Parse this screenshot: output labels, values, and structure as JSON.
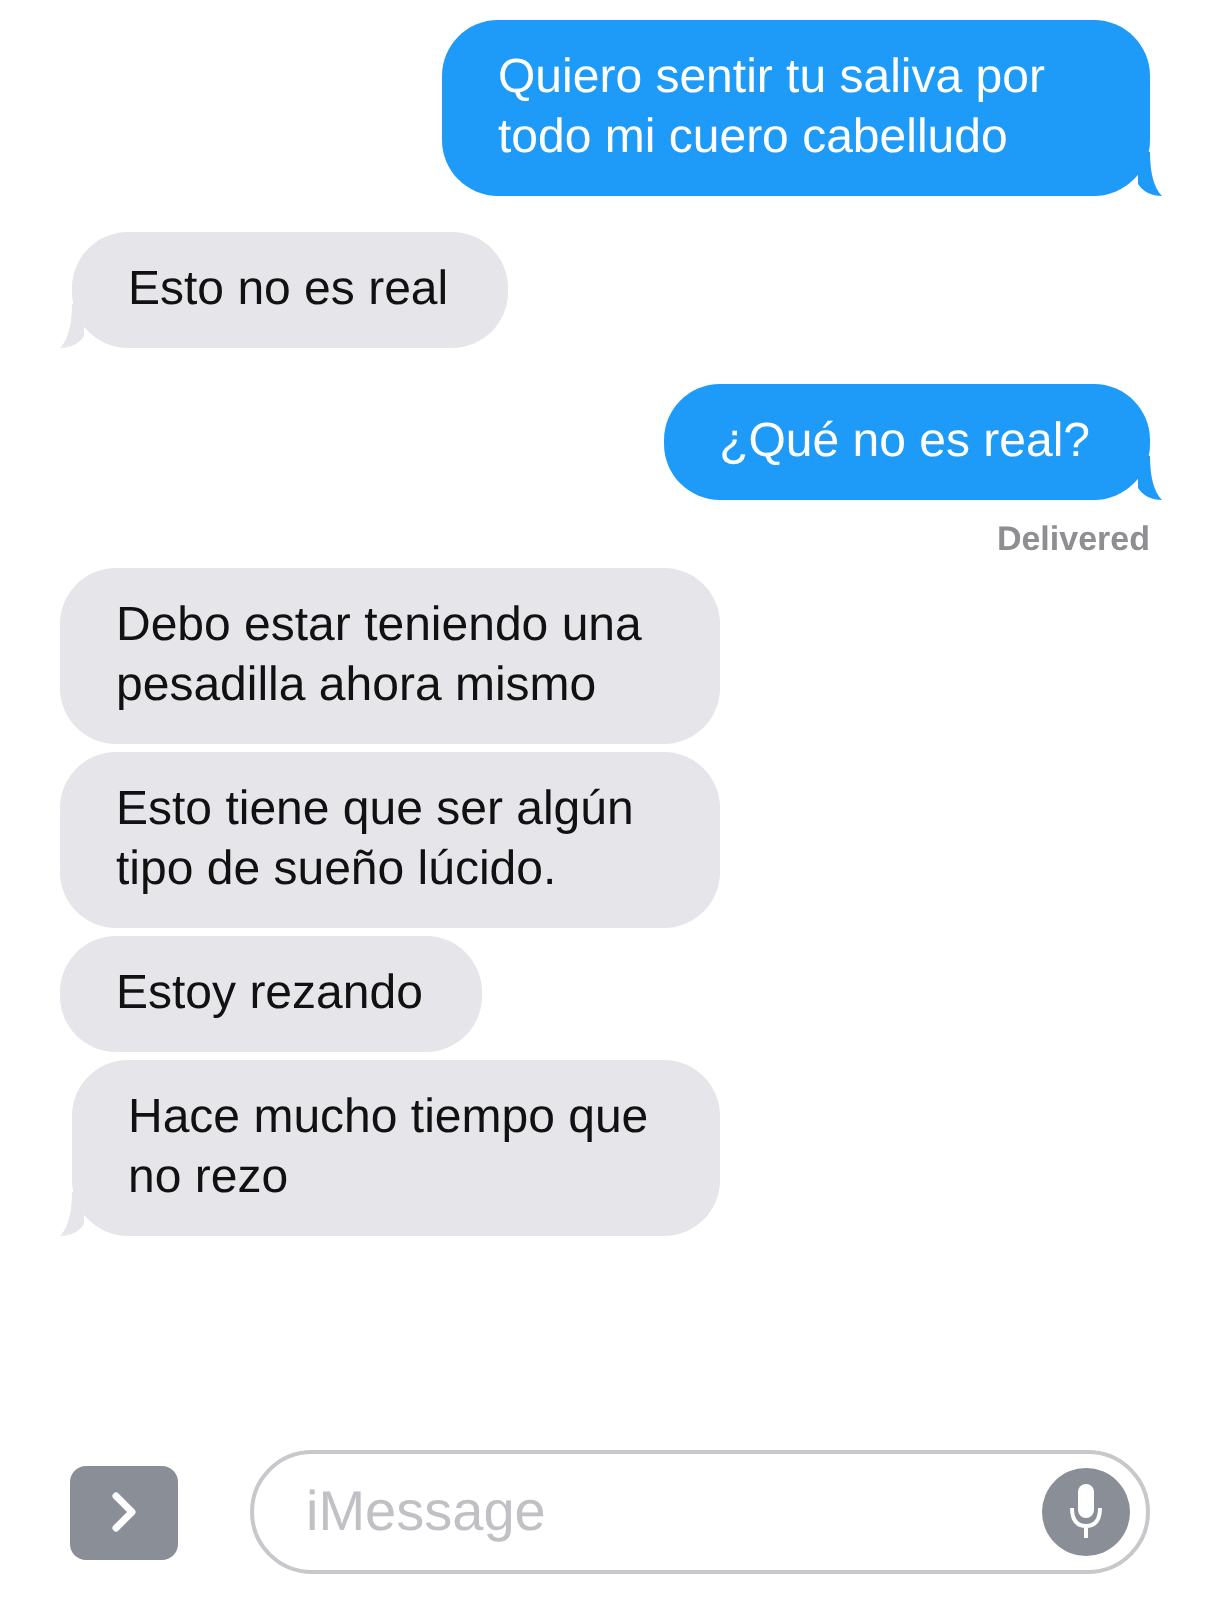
{
  "messages": [
    {
      "kind": "sent",
      "text": "Quiero sentir tu saliva por todo mi cuero cabelludo"
    },
    {
      "kind": "received",
      "text": "Esto no es real"
    },
    {
      "kind": "sent",
      "text": "¿Qué no es real?",
      "status": "Delivered"
    },
    {
      "kind": "received",
      "text": "Debo estar teniendo una pesadilla ahora mismo"
    },
    {
      "kind": "received",
      "text": "Esto tiene que ser algún tipo de sueño lúcido."
    },
    {
      "kind": "received",
      "text": "Estoy rezando"
    },
    {
      "kind": "received",
      "text": "Hace mucho tiempo que no rezo"
    }
  ],
  "composer": {
    "placeholder": "iMessage"
  }
}
